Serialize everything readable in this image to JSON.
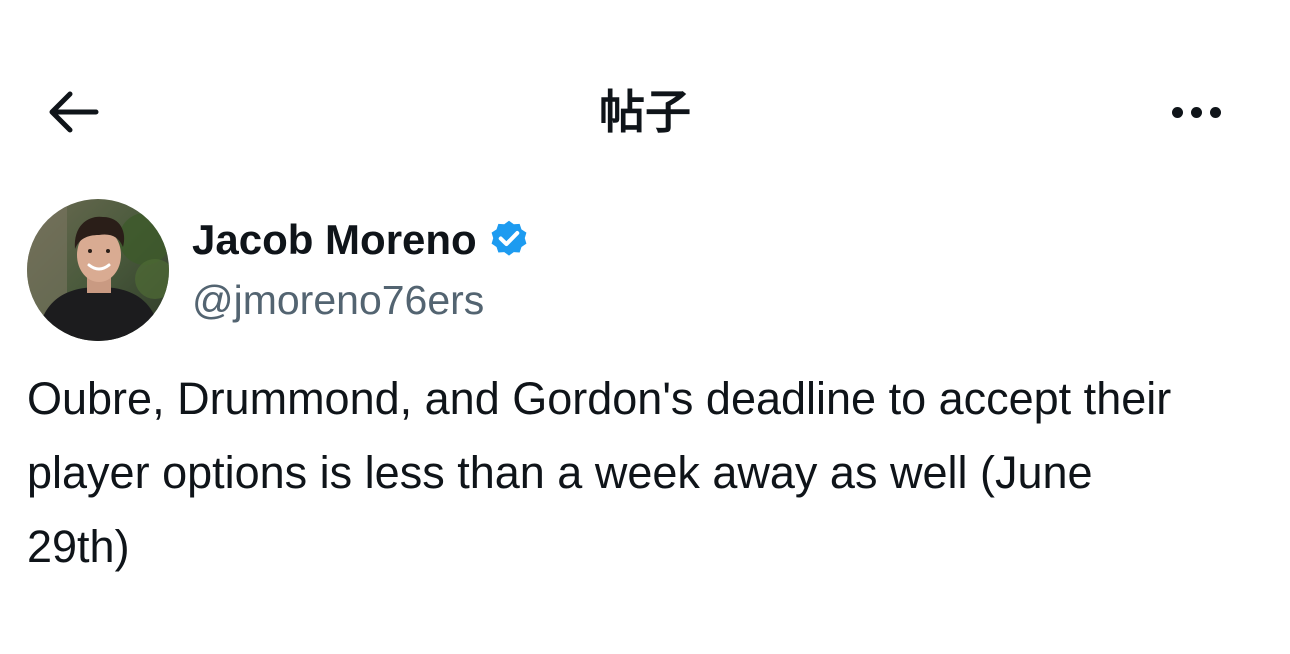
{
  "header": {
    "title": "帖子",
    "back_icon": "arrow-left-icon",
    "more_icon": "more-horizontal-icon"
  },
  "author": {
    "name": "Jacob Moreno",
    "handle": "@jmoreno76ers",
    "verified": true,
    "verified_color": "#1d9bf0"
  },
  "tweet": {
    "text": "Oubre, Drummond, and Gordon's deadline to accept their player options is less than a week away as well (June 29th)"
  },
  "colors": {
    "text_primary": "#0f1419",
    "text_secondary": "#536471",
    "background": "#ffffff"
  }
}
